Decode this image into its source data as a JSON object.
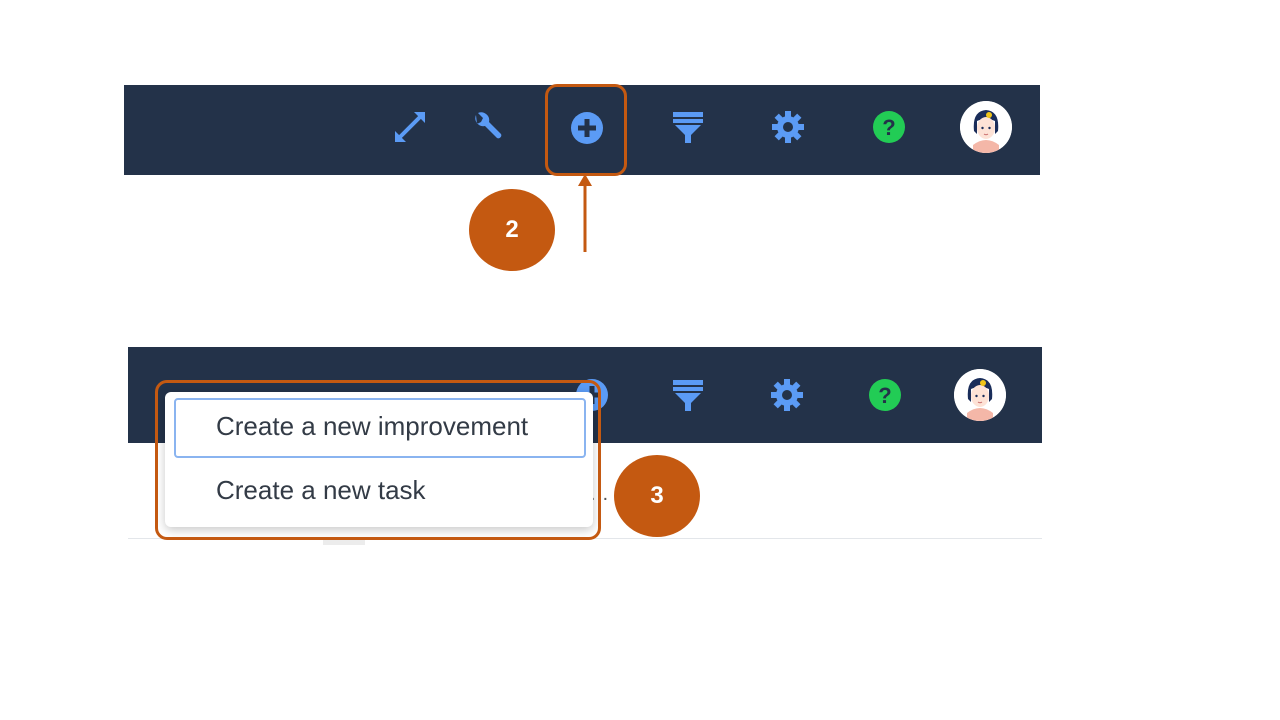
{
  "toolbar": {
    "icons": {
      "expand": "expand-arrows-icon",
      "tools": "wrench-icon",
      "add": "plus-circle-icon",
      "filter": "funnel-icon",
      "settings": "gear-icon",
      "help": "question-circle-icon",
      "avatar": "user-avatar"
    },
    "colors": {
      "bar": "#233249",
      "icon_blue": "#5b9bf5",
      "help_green": "#22cc55"
    }
  },
  "steps": {
    "step2": "2",
    "step3": "3"
  },
  "dropdown": {
    "items": [
      {
        "label": "Create a new improvement"
      },
      {
        "label": "Create a new task"
      }
    ]
  },
  "content": {
    "fragment": "…"
  },
  "annotation_color": "#c45911"
}
